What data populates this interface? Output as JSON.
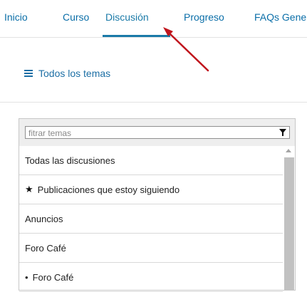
{
  "tabs": [
    {
      "label": "Inicio"
    },
    {
      "label": "Curso"
    },
    {
      "label": "Discusión"
    },
    {
      "label": "Progreso"
    },
    {
      "label": "FAQs Gene"
    }
  ],
  "topics_toggle": {
    "label": "Todos los temas",
    "icon": "hamburger-icon"
  },
  "filter": {
    "placeholder": "fitrar temas",
    "icon": "filter-funnel-icon"
  },
  "topics": [
    {
      "label": "Todas las discusiones",
      "starred": false
    },
    {
      "label": "Publicaciones que estoy siguiendo",
      "starred": true
    },
    {
      "label": "Anuncios",
      "starred": false
    },
    {
      "label": "Foro Café",
      "starred": false
    },
    {
      "label": "Foro Café",
      "starred": false
    }
  ],
  "colors": {
    "link": "#1d6fa5",
    "active_tab_underline": "#1a7aa8",
    "annotation_arrow": "#c0141c"
  }
}
